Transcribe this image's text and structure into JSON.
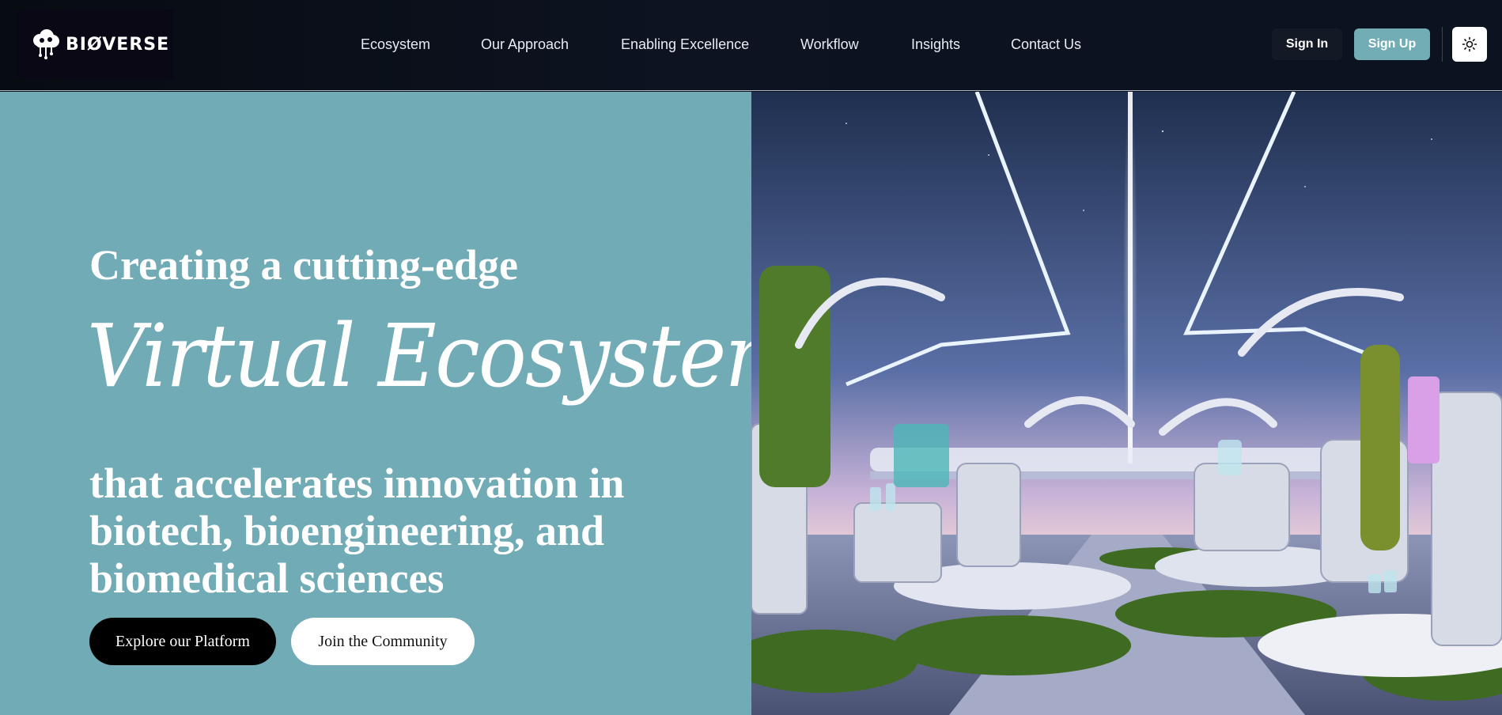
{
  "brand": {
    "name": "BIØVERSE"
  },
  "nav": {
    "links": [
      "Ecosystem",
      "Our Approach",
      "Enabling Excellence",
      "Workflow",
      "Insights",
      "Contact Us"
    ],
    "sign_in": "Sign In",
    "sign_up": "Sign Up",
    "theme_icon": "sun-icon"
  },
  "hero": {
    "line1": "Creating a cutting-edge",
    "script": "Virtual Ecosystem",
    "line3": "that accelerates innovation in biotech, bioengineering, and biomedical sciences",
    "primary_cta": "Explore our Platform",
    "secondary_cta": "Join the Community",
    "image_icon": "futuristic-lab-illustration"
  },
  "colors": {
    "nav_bg": "#0d1320",
    "hero_bg": "#71abb5",
    "accent": "#72acb5",
    "primary_button": "#000000"
  }
}
